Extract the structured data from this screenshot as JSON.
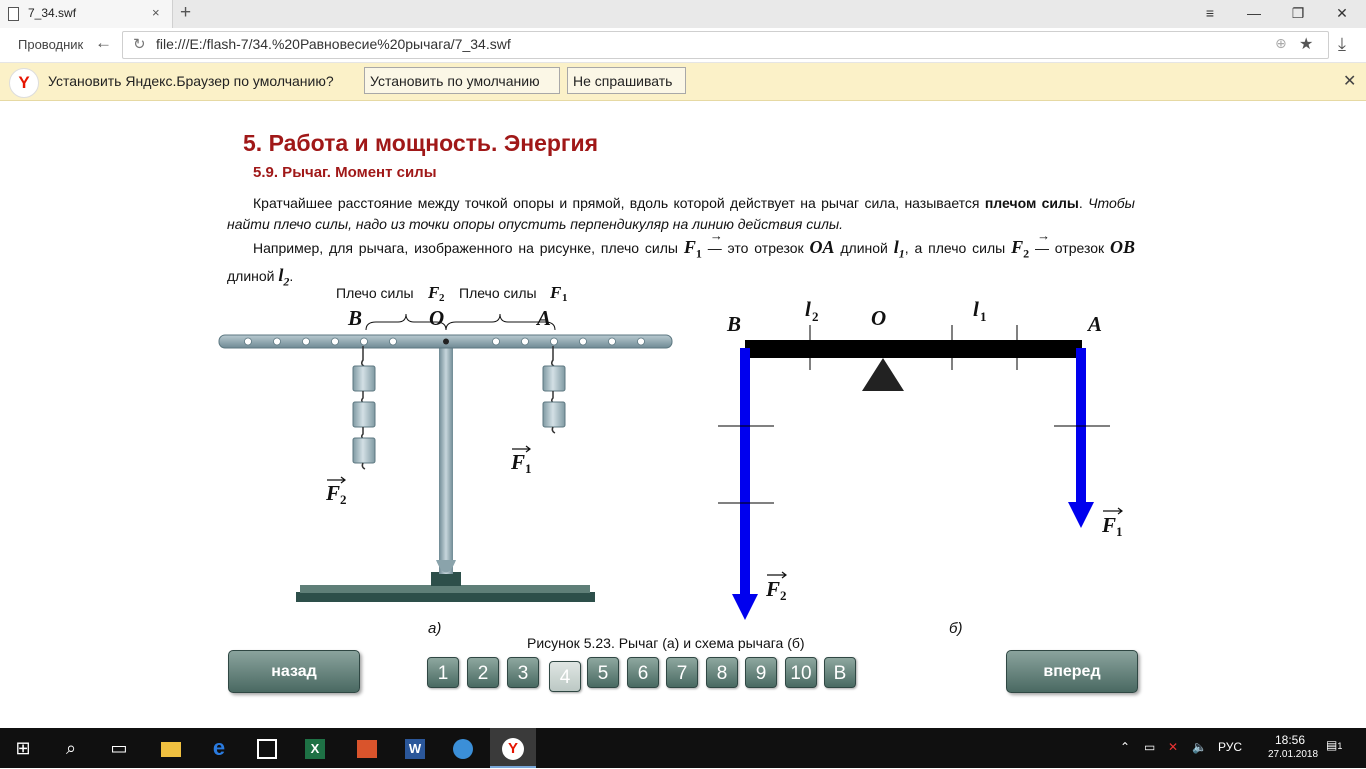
{
  "browser": {
    "tab_title": "7_34.swf",
    "tab_close": "×",
    "new_tab": "+",
    "window_menu": "≡",
    "window_minimize": "—",
    "window_maximize": "❐",
    "window_close": "✕",
    "explorer_label": "Проводник",
    "back": "←",
    "reload": "↻",
    "url": "file:///E:/flash-7/34.%20Равновесие%20рычага/7_34.swf",
    "globe": "⊕",
    "star": "★",
    "download": "⤓"
  },
  "infobar": {
    "logo": "Y",
    "message": "Установить Яндекс.Браузер по умолчанию?",
    "set_default": "Установить по умолчанию",
    "dont_ask": "Не спрашивать",
    "close": "✕"
  },
  "content": {
    "title": "5. Работа и мощность. Энергия",
    "subtitle": "5.9. Рычаг. Момент силы",
    "p1_start": "Кратчайшее расстояние между точкой опоры и прямой, вдоль которой действует на рычаг сила, называется ",
    "p1_bold": "плечом силы",
    "p1_dot": ". ",
    "p1_italic": "Чтобы найти плечо силы, надо из точки опоры опустить перпендикуляр на линию действия силы.",
    "p2_a": "Например, для рычага, изображенного на рисунке, плечо силы ",
    "p2_F1": "F",
    "p2_F1_sub": "1",
    "p2_b": " — это отрезок ",
    "p2_OA": "OA",
    "p2_c": " длиной ",
    "p2_l1": "l",
    "p2_l1_sub": "1",
    "p2_d": ", а плечо силы ",
    "p2_F2": "F",
    "p2_F2_sub": "2",
    "p2_e": " — отрезок ",
    "p2_OB": "OB",
    "p2_f": " длиной ",
    "p2_l2": "l",
    "p2_l2_sub": "2",
    "p2_g": "."
  },
  "figure": {
    "arm_label_2": "Плечо силы",
    "arm_label_1": "Плечо силы",
    "F": "F",
    "sub1": "1",
    "sub2": "2",
    "l": "l",
    "B": "B",
    "O": "O",
    "A": "A",
    "part_a": "а)",
    "part_b": "б)",
    "caption": "Рисунок 5.23. Рычаг (а) и схема рычага (б)"
  },
  "nav": {
    "back": "назад",
    "forward": "вперед",
    "pages": [
      "1",
      "2",
      "3",
      "4",
      "5",
      "6",
      "7",
      "8",
      "9",
      "10",
      "В"
    ],
    "current_page": "4"
  },
  "taskbar": {
    "start": "⊞",
    "search": "⌕",
    "taskview": "▭",
    "lang": "РУС",
    "time": "18:56",
    "date": "27.01.2018",
    "notification_count": "1"
  },
  "colors": {
    "heading": "#a01818",
    "force_arrow": "#0000ee",
    "nav_button": "#5a7a73",
    "infobar": "#fbf1c8"
  }
}
